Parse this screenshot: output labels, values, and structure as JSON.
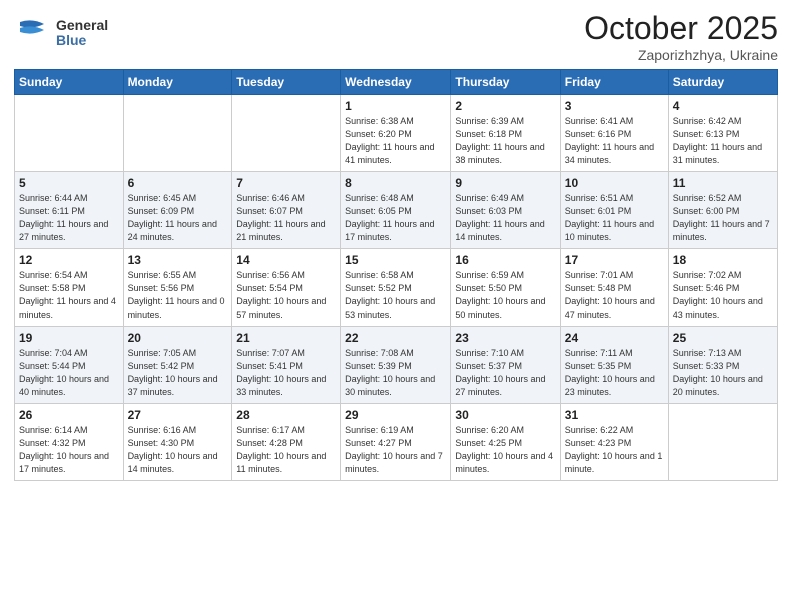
{
  "header": {
    "logo_general": "General",
    "logo_blue": "Blue",
    "month_title": "October 2025",
    "subtitle": "Zaporizhzhya, Ukraine"
  },
  "days_of_week": [
    "Sunday",
    "Monday",
    "Tuesday",
    "Wednesday",
    "Thursday",
    "Friday",
    "Saturday"
  ],
  "weeks": [
    [
      {
        "day": "",
        "sunrise": "",
        "sunset": "",
        "daylight": ""
      },
      {
        "day": "",
        "sunrise": "",
        "sunset": "",
        "daylight": ""
      },
      {
        "day": "",
        "sunrise": "",
        "sunset": "",
        "daylight": ""
      },
      {
        "day": "1",
        "sunrise": "Sunrise: 6:38 AM",
        "sunset": "Sunset: 6:20 PM",
        "daylight": "Daylight: 11 hours and 41 minutes."
      },
      {
        "day": "2",
        "sunrise": "Sunrise: 6:39 AM",
        "sunset": "Sunset: 6:18 PM",
        "daylight": "Daylight: 11 hours and 38 minutes."
      },
      {
        "day": "3",
        "sunrise": "Sunrise: 6:41 AM",
        "sunset": "Sunset: 6:16 PM",
        "daylight": "Daylight: 11 hours and 34 minutes."
      },
      {
        "day": "4",
        "sunrise": "Sunrise: 6:42 AM",
        "sunset": "Sunset: 6:13 PM",
        "daylight": "Daylight: 11 hours and 31 minutes."
      }
    ],
    [
      {
        "day": "5",
        "sunrise": "Sunrise: 6:44 AM",
        "sunset": "Sunset: 6:11 PM",
        "daylight": "Daylight: 11 hours and 27 minutes."
      },
      {
        "day": "6",
        "sunrise": "Sunrise: 6:45 AM",
        "sunset": "Sunset: 6:09 PM",
        "daylight": "Daylight: 11 hours and 24 minutes."
      },
      {
        "day": "7",
        "sunrise": "Sunrise: 6:46 AM",
        "sunset": "Sunset: 6:07 PM",
        "daylight": "Daylight: 11 hours and 21 minutes."
      },
      {
        "day": "8",
        "sunrise": "Sunrise: 6:48 AM",
        "sunset": "Sunset: 6:05 PM",
        "daylight": "Daylight: 11 hours and 17 minutes."
      },
      {
        "day": "9",
        "sunrise": "Sunrise: 6:49 AM",
        "sunset": "Sunset: 6:03 PM",
        "daylight": "Daylight: 11 hours and 14 minutes."
      },
      {
        "day": "10",
        "sunrise": "Sunrise: 6:51 AM",
        "sunset": "Sunset: 6:01 PM",
        "daylight": "Daylight: 11 hours and 10 minutes."
      },
      {
        "day": "11",
        "sunrise": "Sunrise: 6:52 AM",
        "sunset": "Sunset: 6:00 PM",
        "daylight": "Daylight: 11 hours and 7 minutes."
      }
    ],
    [
      {
        "day": "12",
        "sunrise": "Sunrise: 6:54 AM",
        "sunset": "Sunset: 5:58 PM",
        "daylight": "Daylight: 11 hours and 4 minutes."
      },
      {
        "day": "13",
        "sunrise": "Sunrise: 6:55 AM",
        "sunset": "Sunset: 5:56 PM",
        "daylight": "Daylight: 11 hours and 0 minutes."
      },
      {
        "day": "14",
        "sunrise": "Sunrise: 6:56 AM",
        "sunset": "Sunset: 5:54 PM",
        "daylight": "Daylight: 10 hours and 57 minutes."
      },
      {
        "day": "15",
        "sunrise": "Sunrise: 6:58 AM",
        "sunset": "Sunset: 5:52 PM",
        "daylight": "Daylight: 10 hours and 53 minutes."
      },
      {
        "day": "16",
        "sunrise": "Sunrise: 6:59 AM",
        "sunset": "Sunset: 5:50 PM",
        "daylight": "Daylight: 10 hours and 50 minutes."
      },
      {
        "day": "17",
        "sunrise": "Sunrise: 7:01 AM",
        "sunset": "Sunset: 5:48 PM",
        "daylight": "Daylight: 10 hours and 47 minutes."
      },
      {
        "day": "18",
        "sunrise": "Sunrise: 7:02 AM",
        "sunset": "Sunset: 5:46 PM",
        "daylight": "Daylight: 10 hours and 43 minutes."
      }
    ],
    [
      {
        "day": "19",
        "sunrise": "Sunrise: 7:04 AM",
        "sunset": "Sunset: 5:44 PM",
        "daylight": "Daylight: 10 hours and 40 minutes."
      },
      {
        "day": "20",
        "sunrise": "Sunrise: 7:05 AM",
        "sunset": "Sunset: 5:42 PM",
        "daylight": "Daylight: 10 hours and 37 minutes."
      },
      {
        "day": "21",
        "sunrise": "Sunrise: 7:07 AM",
        "sunset": "Sunset: 5:41 PM",
        "daylight": "Daylight: 10 hours and 33 minutes."
      },
      {
        "day": "22",
        "sunrise": "Sunrise: 7:08 AM",
        "sunset": "Sunset: 5:39 PM",
        "daylight": "Daylight: 10 hours and 30 minutes."
      },
      {
        "day": "23",
        "sunrise": "Sunrise: 7:10 AM",
        "sunset": "Sunset: 5:37 PM",
        "daylight": "Daylight: 10 hours and 27 minutes."
      },
      {
        "day": "24",
        "sunrise": "Sunrise: 7:11 AM",
        "sunset": "Sunset: 5:35 PM",
        "daylight": "Daylight: 10 hours and 23 minutes."
      },
      {
        "day": "25",
        "sunrise": "Sunrise: 7:13 AM",
        "sunset": "Sunset: 5:33 PM",
        "daylight": "Daylight: 10 hours and 20 minutes."
      }
    ],
    [
      {
        "day": "26",
        "sunrise": "Sunrise: 6:14 AM",
        "sunset": "Sunset: 4:32 PM",
        "daylight": "Daylight: 10 hours and 17 minutes."
      },
      {
        "day": "27",
        "sunrise": "Sunrise: 6:16 AM",
        "sunset": "Sunset: 4:30 PM",
        "daylight": "Daylight: 10 hours and 14 minutes."
      },
      {
        "day": "28",
        "sunrise": "Sunrise: 6:17 AM",
        "sunset": "Sunset: 4:28 PM",
        "daylight": "Daylight: 10 hours and 11 minutes."
      },
      {
        "day": "29",
        "sunrise": "Sunrise: 6:19 AM",
        "sunset": "Sunset: 4:27 PM",
        "daylight": "Daylight: 10 hours and 7 minutes."
      },
      {
        "day": "30",
        "sunrise": "Sunrise: 6:20 AM",
        "sunset": "Sunset: 4:25 PM",
        "daylight": "Daylight: 10 hours and 4 minutes."
      },
      {
        "day": "31",
        "sunrise": "Sunrise: 6:22 AM",
        "sunset": "Sunset: 4:23 PM",
        "daylight": "Daylight: 10 hours and 1 minute."
      },
      {
        "day": "",
        "sunrise": "",
        "sunset": "",
        "daylight": ""
      }
    ]
  ]
}
